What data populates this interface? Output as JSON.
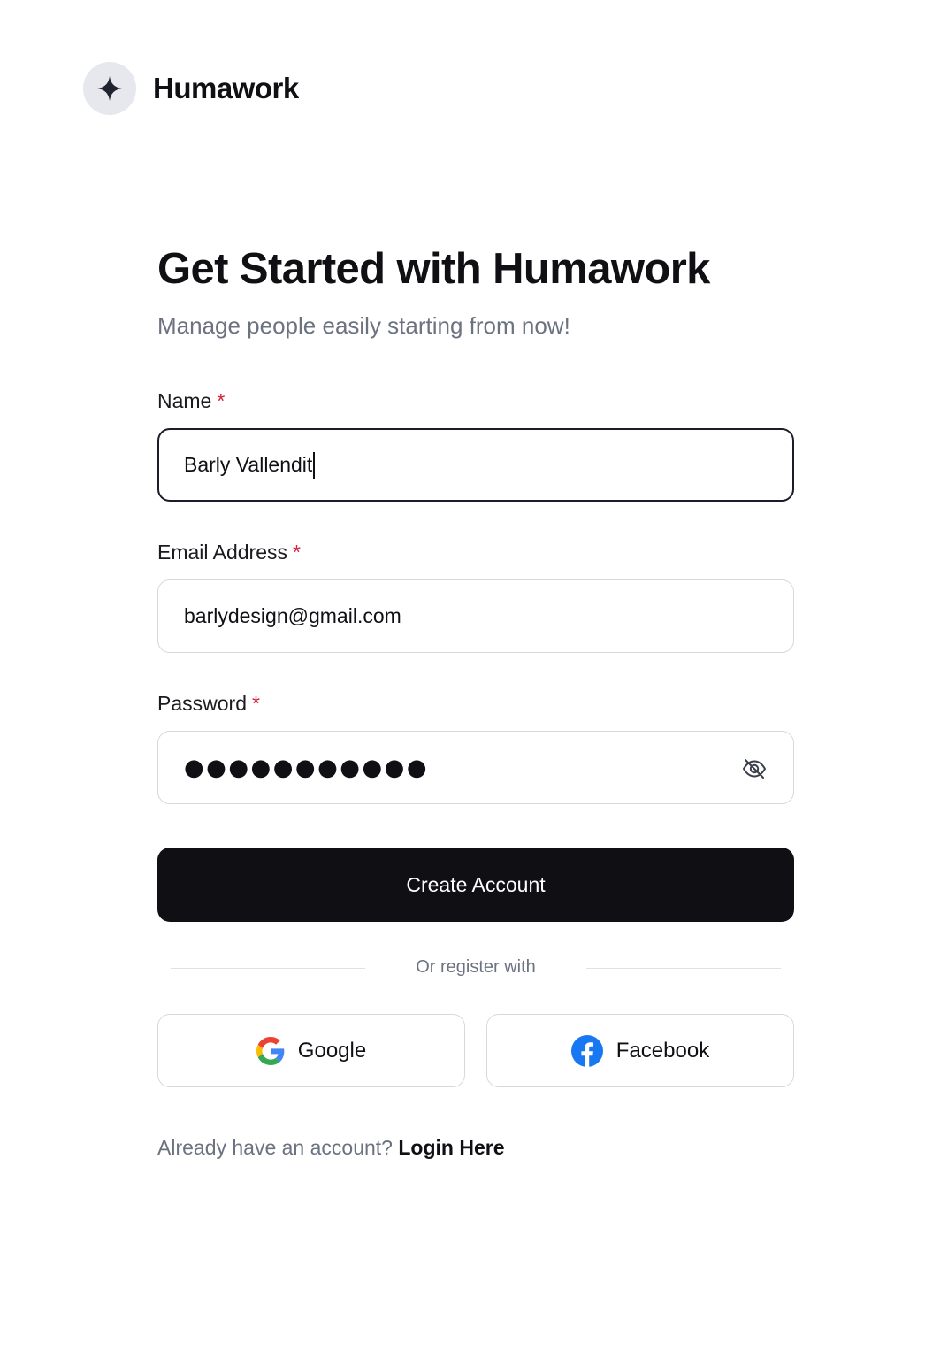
{
  "brand": {
    "name": "Humawork",
    "icon": "sparkle-icon"
  },
  "heading": {
    "title": "Get Started with Humawork",
    "subtitle": "Manage people easily starting from now!"
  },
  "form": {
    "required_mark": "*",
    "name": {
      "label": "Name",
      "value": "Barly Vallendit"
    },
    "email": {
      "label": "Email Address",
      "value": "barlydesign@gmail.com"
    },
    "password": {
      "label": "Password",
      "masked": "●●●●●●●●●●●",
      "toggle_icon": "eye-off-icon"
    },
    "submit_label": "Create Account"
  },
  "social": {
    "divider_text": "Or register with",
    "google_label": "Google",
    "facebook_label": "Facebook"
  },
  "footer": {
    "prompt": "Already have an account?",
    "link": "Login Here"
  },
  "colors": {
    "primary": "#0f0f14",
    "required": "#d4213d",
    "muted": "#6b7280",
    "facebook": "#1877f2"
  }
}
